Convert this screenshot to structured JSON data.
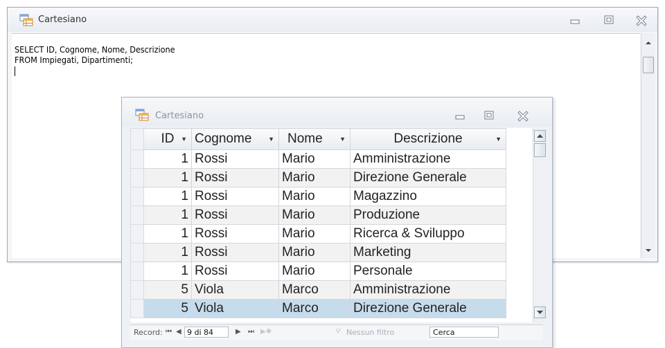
{
  "sql_window": {
    "title": "Cartesiano",
    "sql_lines": [
      "SELECT ID, Cognome, Nome, Descrizione",
      "FROM Impiegati, Dipartimenti;"
    ]
  },
  "datasheet": {
    "title": "Cartesiano",
    "columns": [
      "ID",
      "Cognome",
      "Nome",
      "Descrizione"
    ],
    "rows": [
      {
        "id": "1",
        "cognome": "Rossi",
        "nome": "Mario",
        "descrizione": "Amministrazione"
      },
      {
        "id": "1",
        "cognome": "Rossi",
        "nome": "Mario",
        "descrizione": "Direzione  Generale"
      },
      {
        "id": "1",
        "cognome": "Rossi",
        "nome": "Mario",
        "descrizione": "Magazzino"
      },
      {
        "id": "1",
        "cognome": "Rossi",
        "nome": "Mario",
        "descrizione": "Produzione"
      },
      {
        "id": "1",
        "cognome": "Rossi",
        "nome": "Mario",
        "descrizione": "Ricerca & Sviluppo"
      },
      {
        "id": "1",
        "cognome": "Rossi",
        "nome": "Mario",
        "descrizione": "Marketing"
      },
      {
        "id": "1",
        "cognome": "Rossi",
        "nome": "Mario",
        "descrizione": "Personale"
      },
      {
        "id": "5",
        "cognome": "Viola",
        "nome": "Marco",
        "descrizione": "Amministrazione"
      },
      {
        "id": "5",
        "cognome": "Viola",
        "nome": "Marco",
        "descrizione": "Direzione  Generale"
      }
    ],
    "navigation": {
      "record_label": "Record:",
      "record_value": "9 di 84",
      "filter_label": "Nessun filtro",
      "search_value": "Cerca"
    }
  },
  "colors": {
    "selected_row": "#c6dcec",
    "alt_row": "#f2f2f2",
    "window_border": "#9aa8b8"
  },
  "icons": [
    "query-icon",
    "minimize-icon",
    "maximize-icon",
    "close-icon",
    "dropdown-arrow-icon",
    "first-record-icon",
    "previous-record-icon",
    "next-record-icon",
    "last-record-icon",
    "new-record-icon",
    "filter-icon"
  ]
}
